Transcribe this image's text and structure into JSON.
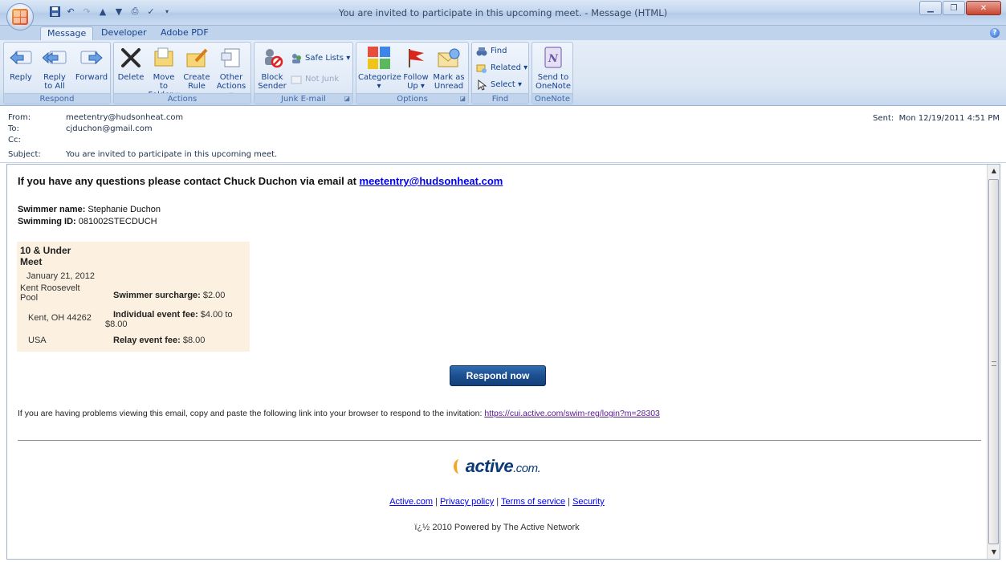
{
  "window": {
    "title": "You are invited to participate in this upcoming meet. - Message (HTML)",
    "minimize": "▁",
    "maximize": "❐",
    "close": "✕"
  },
  "tabs": [
    {
      "label": "Message",
      "active": true
    },
    {
      "label": "Developer",
      "active": false
    },
    {
      "label": "Adobe PDF",
      "active": false
    }
  ],
  "ribbon": {
    "respond": {
      "label": "Respond",
      "reply": "Reply",
      "reply_all_1": "Reply",
      "reply_all_2": "to All",
      "forward": "Forward"
    },
    "actions": {
      "label": "Actions",
      "delete": "Delete",
      "move_1": "Move to",
      "move_2": "Folder ▾",
      "rule_1": "Create",
      "rule_2": "Rule",
      "other_1": "Other",
      "other_2": "Actions ▾"
    },
    "junk": {
      "label": "Junk E-mail",
      "block_1": "Block",
      "block_2": "Sender",
      "safe_lists": "Safe Lists ▾",
      "not_junk": "Not Junk"
    },
    "options": {
      "label": "Options",
      "categorize": "Categorize",
      "categorize_2": "▾",
      "follow_1": "Follow",
      "follow_2": "Up ▾",
      "mark_1": "Mark as",
      "mark_2": "Unread"
    },
    "find": {
      "label": "Find",
      "find": "Find",
      "related": "Related ▾",
      "select": "Select ▾"
    },
    "onenote": {
      "label": "OneNote",
      "send_1": "Send to",
      "send_2": "OneNote"
    }
  },
  "header": {
    "from_label": "From:",
    "from_value": "meetentry@hudsonheat.com",
    "to_label": "To:",
    "to_value": "cjduchon@gmail.com",
    "cc_label": "Cc:",
    "cc_value": "",
    "subject_label": "Subject:",
    "subject_value": "You are invited to participate in this upcoming meet.",
    "sent_label": "Sent:",
    "sent_value": "Mon 12/19/2011 4:51 PM"
  },
  "email": {
    "questions_text": "If you have any questions please contact Chuck Duchon via email at ",
    "questions_email": "meetentry@hudsonheat.com",
    "swimmer_name_label": "Swimmer name:",
    "swimmer_name_value": " Stephanie Duchon",
    "swimming_id_label": "Swimming ID:",
    "swimming_id_value": " 081002STECDUCH",
    "meet": {
      "title": "10 & Under Meet",
      "date": "January 21, 2012",
      "venue": "Kent Roosevelt Pool",
      "city": "Kent, OH 44262",
      "country": "USA",
      "surcharge_label": "Swimmer surcharge:",
      "surcharge_value": " $2.00",
      "individual_label": "Individual event fee:",
      "individual_value": " $4.00 to $8.00",
      "relay_label": "Relay event fee:",
      "relay_value": " $8.00"
    },
    "respond_button": "Respond now",
    "problems_text": "If you are having problems viewing this email, copy and paste the following link into your browser to respond to the invitation: ",
    "problems_link": "https://cui.active.com/swim-reg/login?m=28303",
    "logo_main": "active",
    "logo_suffix": ".com.",
    "footer_links": [
      "Active.com",
      "Privacy policy",
      "Terms of service",
      "Security"
    ],
    "footer_sep": " | ",
    "copyright": "ï¿½ 2010 Powered by The Active Network"
  },
  "colors": {
    "ribbon_text": "#15428b",
    "respond_button_bg": "#1d4f8f",
    "meet_box_bg": "#fcf1e0",
    "link": "#0000ee",
    "visited_link": "#551a8b"
  }
}
